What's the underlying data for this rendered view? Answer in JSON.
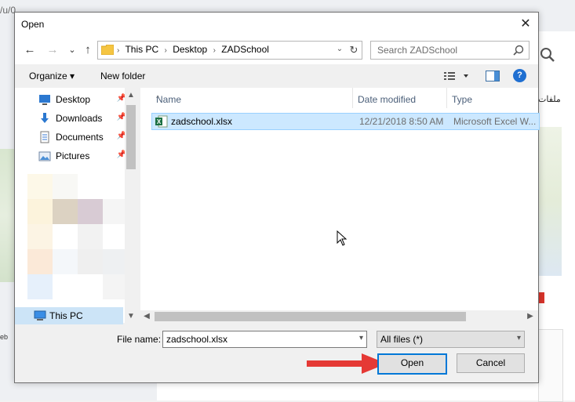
{
  "background": {
    "url_fragment": "/u/0",
    "arabic_text": "ملفات",
    "left_text": "eb"
  },
  "dialog": {
    "title": "Open",
    "close_glyph": "✕",
    "address": {
      "crumbs": [
        "This PC",
        "Desktop",
        "ZADSchool"
      ],
      "dropdown_glyph": "⌄",
      "refresh_glyph": "↻"
    },
    "nav_buttons": {
      "back": "←",
      "forward": "→",
      "recent": "⌄",
      "up": "↑"
    },
    "search": {
      "placeholder": "Search ZADSchool"
    },
    "toolbar": {
      "organize": "Organize ▾",
      "new_folder": "New folder",
      "help": "?"
    },
    "nav_items": [
      {
        "label": "Desktop",
        "icon": "desktop-icon",
        "pin": "📌"
      },
      {
        "label": "Downloads",
        "icon": "downloads-icon",
        "pin": "📌"
      },
      {
        "label": "Documents",
        "icon": "documents-icon",
        "pin": "📌"
      },
      {
        "label": "Pictures",
        "icon": "pictures-icon",
        "pin": "📌"
      }
    ],
    "this_pc": "This PC",
    "columns": {
      "name": "Name",
      "date": "Date modified",
      "type": "Type"
    },
    "files": [
      {
        "name": "zadschool.xlsx",
        "date": "12/21/2018 8:50 AM",
        "type": "Microsoft Excel W...",
        "icon": "excel-icon",
        "selected": true
      }
    ],
    "file_name_label": "File name:",
    "file_name_value": "zadschool.xlsx",
    "file_type_filter": "All files (*)",
    "open_button": "Open",
    "cancel_button": "Cancel"
  },
  "colors": {
    "selection": "#cce8ff",
    "accent": "#0078d7",
    "annotation_arrow": "#e53935"
  }
}
